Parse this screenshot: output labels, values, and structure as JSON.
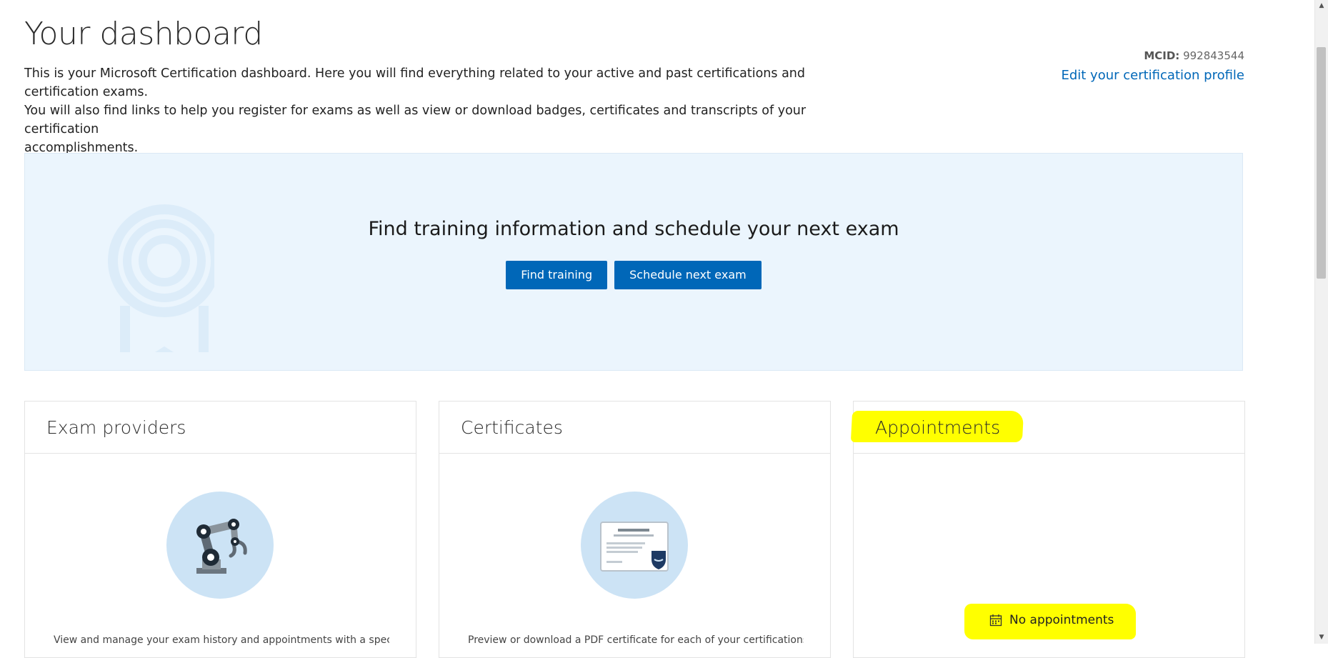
{
  "header": {
    "title": "Your dashboard",
    "intro_line1": "This is your Microsoft Certification dashboard. Here you will find everything related to your active and past certifications and certification exams.",
    "intro_line2": "You will also find links to help you register for exams as well as view or download badges, certificates and transcripts of your certification",
    "intro_line3": "accomplishments.",
    "mcid_label": "MCID:",
    "mcid_value": "992843544",
    "edit_profile_link": "Edit your certification profile"
  },
  "banner": {
    "heading": "Find training information and schedule your next exam",
    "find_training_label": "Find training",
    "schedule_exam_label": "Schedule next exam"
  },
  "cards": {
    "exam_providers": {
      "title": "Exam providers",
      "icon": "robot-arm-icon",
      "description": "View and manage your exam history and appointments with a specific"
    },
    "certificates": {
      "title": "Certificates",
      "icon": "certificate-document-icon",
      "description": "Preview or download a PDF certificate for each of your certifications"
    },
    "appointments": {
      "title": "Appointments",
      "empty_text": "No appointments",
      "icon": "calendar-icon"
    }
  },
  "colors": {
    "accent": "#0067b8",
    "banner_background": "#ebf5fd",
    "highlight": "#ffff00",
    "icon_circle": "#cce3f5"
  }
}
